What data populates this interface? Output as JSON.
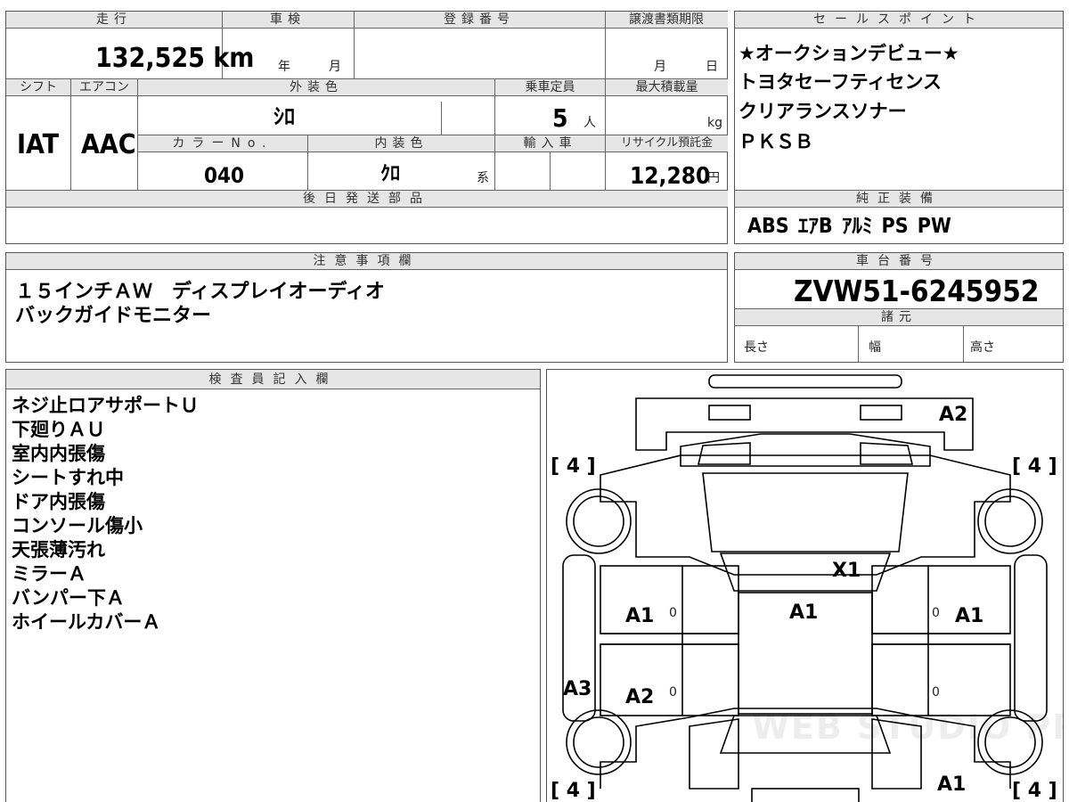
{
  "top_info": {
    "headers": {
      "mileage": "走行",
      "shaken": "車検",
      "registration": "登録番号",
      "transfer_deadline": "譲渡書類期限"
    },
    "mileage": "132,525 km",
    "shaken_year_unit": "年",
    "shaken_month_unit": "月",
    "transfer_month_unit": "月",
    "transfer_day_unit": "日"
  },
  "spec_row": {
    "headers": {
      "shift": "シフト",
      "aircon": "エアコン",
      "exterior_color": "外装色",
      "capacity": "乗車定員",
      "max_load": "最大積載量",
      "color_no": "カラーNo.",
      "interior_color": "内装色",
      "import": "輸入車",
      "recycle": "リサイクル預託金"
    },
    "shift": "IAT",
    "aircon": "AAC",
    "exterior_color": "ｼﾛ",
    "capacity": "5",
    "capacity_unit": "人",
    "max_load_unit": "kg",
    "color_no": "040",
    "interior_color": "ｸﾛ",
    "interior_color_suffix": "系",
    "recycle_fee": "12,280",
    "recycle_unit": "円"
  },
  "later_parts": {
    "header": "後日発送部品"
  },
  "sales_points": {
    "header": "セールスポイント",
    "lines": [
      "★オークションデビュー★",
      "トヨタセーフティセンス",
      "クリアランスソナー",
      "ＰＫＳＢ"
    ]
  },
  "genuine_equipment": {
    "header": "純正装備",
    "items": "ABS ｴｱB ｱﾙﾐ PS PW"
  },
  "notes": {
    "header": "注意事項欄",
    "lines": [
      "１５インチＡＷ　ディスプレイオーディオ",
      "バックガイドモニター"
    ]
  },
  "chassis": {
    "header": "車台番号",
    "number": "ZVW51-6245952",
    "specs_header": "諸元",
    "length_label": "長さ",
    "width_label": "幅",
    "height_label": "高さ"
  },
  "inspector": {
    "header": "検査員記入欄",
    "lines": [
      "ネジ止ロアサポートＵ",
      "下廻りＡＵ",
      "室内内張傷",
      "シートすれ中",
      "ドア内張傷",
      "コンソール傷小",
      "天張薄汚れ",
      "ミラーＡ",
      "バンパー下Ａ",
      "ホイールカバーＡ"
    ]
  },
  "diagram": {
    "tire_fl": "[ 4 ]",
    "tire_fr": "[ 4 ]",
    "tire_rl": "[ 4 ]",
    "tire_rr": "[ 4 ]",
    "bumper_front": "A2",
    "hood": "X1",
    "roof": "A1",
    "left_front_door": "A1",
    "right_front_door": "A1",
    "left_rear_door": "A2",
    "left_sill": "A3",
    "rear_right": "A1",
    "zero_marks": [
      "0",
      "0",
      "0",
      "0"
    ],
    "watermark": "WEB STUDIO PRO"
  }
}
